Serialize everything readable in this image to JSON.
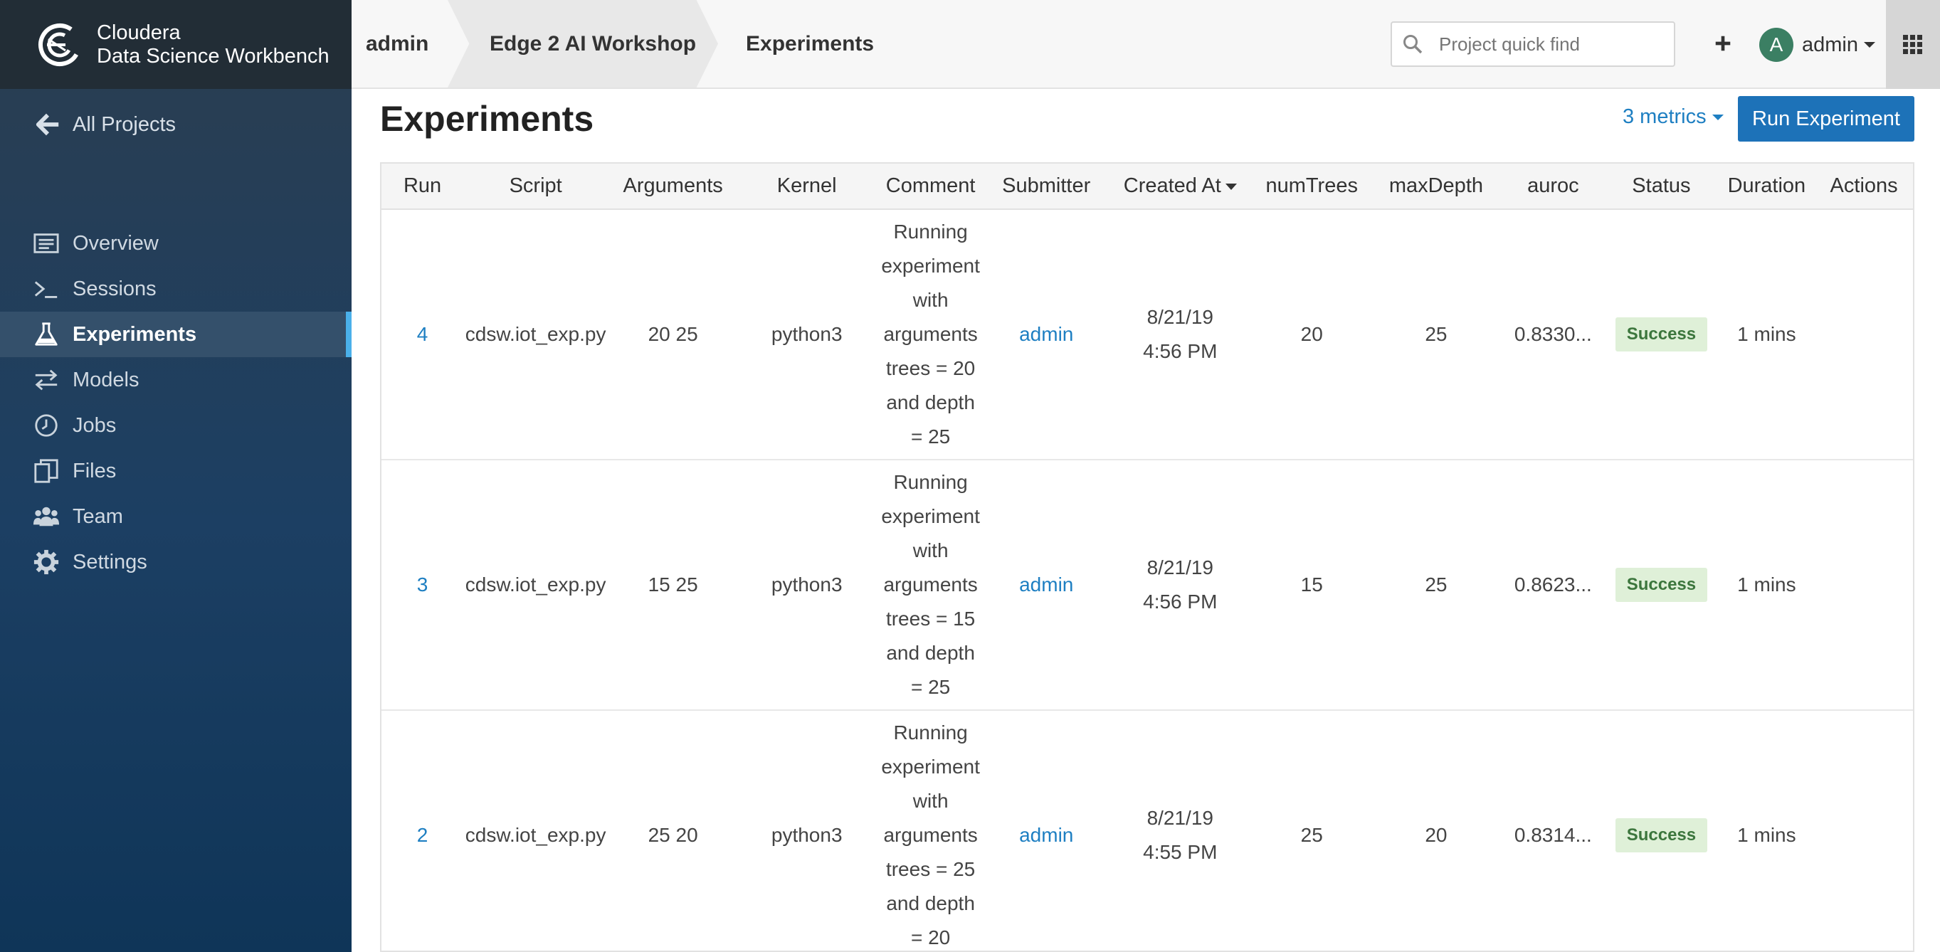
{
  "brand": {
    "line1": "Cloudera",
    "line2": "Data Science Workbench"
  },
  "sidebar": {
    "back_label": "All Projects",
    "items": [
      {
        "label": "Overview",
        "icon": "overview-icon"
      },
      {
        "label": "Sessions",
        "icon": "terminal-icon"
      },
      {
        "label": "Experiments",
        "icon": "flask-icon",
        "active": true
      },
      {
        "label": "Models",
        "icon": "arrows-icon"
      },
      {
        "label": "Jobs",
        "icon": "clock-icon"
      },
      {
        "label": "Files",
        "icon": "files-icon"
      },
      {
        "label": "Team",
        "icon": "team-icon"
      },
      {
        "label": "Settings",
        "icon": "gear-icon"
      }
    ]
  },
  "breadcrumb": {
    "user": "admin",
    "project": "Edge 2 AI Workshop",
    "page": "Experiments"
  },
  "header": {
    "search_placeholder": "Project quick find",
    "avatar_letter": "A",
    "user_label": "admin"
  },
  "main": {
    "title": "Experiments",
    "metrics_label": "3 metrics",
    "run_button": "Run Experiment",
    "columns": [
      "Run",
      "Script",
      "Arguments",
      "Kernel",
      "Comment",
      "Submitter",
      "Created At",
      "numTrees",
      "maxDepth",
      "auroc",
      "Status",
      "Duration",
      "Actions"
    ],
    "rows": [
      {
        "run": "4",
        "script": "cdsw.iot_exp.py",
        "arguments": "20 25",
        "kernel": "python3",
        "comment": "Running experiment with arguments trees = 20 and depth = 25",
        "submitter": "admin",
        "created_date": "8/21/19",
        "created_time": "4:56 PM",
        "numTrees": "20",
        "maxDepth": "25",
        "auroc": "0.8330...",
        "status": "Success",
        "duration": "1 mins"
      },
      {
        "run": "3",
        "script": "cdsw.iot_exp.py",
        "arguments": "15 25",
        "kernel": "python3",
        "comment": "Running experiment with arguments trees = 15 and depth = 25",
        "submitter": "admin",
        "created_date": "8/21/19",
        "created_time": "4:56 PM",
        "numTrees": "15",
        "maxDepth": "25",
        "auroc": "0.8623...",
        "status": "Success",
        "duration": "1 mins"
      },
      {
        "run": "2",
        "script": "cdsw.iot_exp.py",
        "arguments": "25 20",
        "kernel": "python3",
        "comment": "Running experiment with arguments trees = 25 and depth = 20",
        "submitter": "admin",
        "created_date": "8/21/19",
        "created_time": "4:55 PM",
        "numTrees": "25",
        "maxDepth": "20",
        "auroc": "0.8314...",
        "status": "Success",
        "duration": "1 mins"
      }
    ]
  }
}
